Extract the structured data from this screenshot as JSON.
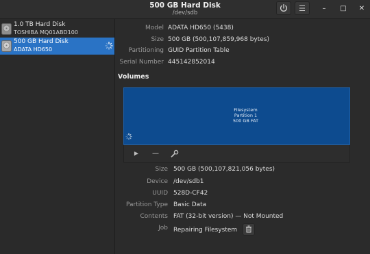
{
  "window": {
    "title": "500 GB Hard Disk",
    "subtitle": "/dev/sdb",
    "power_icon": "power-icon",
    "menu_icon": "hamburger-menu-icon",
    "minimize": "–",
    "maximize": "□",
    "close": "✕"
  },
  "sidebar": {
    "disks": [
      {
        "title": "1.0 TB Hard Disk",
        "model": "TOSHIBA MQ01ABD100",
        "icon": "hard-disk-icon",
        "selected": false
      },
      {
        "title": "500 GB Hard Disk",
        "model": "ADATA HD650",
        "icon": "hard-disk-icon",
        "selected": true
      }
    ]
  },
  "drive": {
    "model_label": "Model",
    "model": "ADATA HD650 (5438)",
    "size_label": "Size",
    "size": "500 GB (500,107,859,968 bytes)",
    "partitioning_label": "Partitioning",
    "partitioning": "GUID Partition Table",
    "serial_label": "Serial Number",
    "serial": "445142852014"
  },
  "volumes": {
    "heading": "Volumes",
    "partition": {
      "line1": "Filesystem",
      "line2": "Partition 1",
      "line3": "500 GB FAT",
      "color": "#0d4b8f"
    },
    "toolbar": {
      "play": "▶",
      "minus": "—",
      "settings_icon": "gears-icon"
    }
  },
  "partition_details": {
    "size_label": "Size",
    "size": "500 GB (500,107,821,056 bytes)",
    "device_label": "Device",
    "device": "/dev/sdb1",
    "uuid_label": "UUID",
    "uuid": "528D-CF42",
    "type_label": "Partition Type",
    "type": "Basic Data",
    "contents_label": "Contents",
    "contents": "FAT (32-bit version) — Not Mounted",
    "job_label": "Job",
    "job": "Repairing Filesystem"
  },
  "colors": {
    "accent": "#2a73c5",
    "background": "#2b2b2b"
  }
}
